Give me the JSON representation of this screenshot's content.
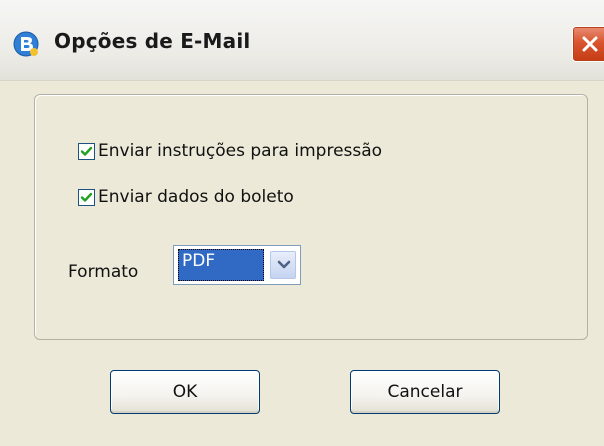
{
  "window": {
    "title": "Opções de E-Mail",
    "app_icon": "b-logo-icon",
    "close_icon": "close-icon"
  },
  "options": {
    "send_instructions": {
      "label": "Enviar instruções para impressão",
      "checked": true
    },
    "send_data": {
      "label": "Enviar dados do boleto",
      "checked": true
    }
  },
  "format": {
    "label": "Formato",
    "selected": "PDF"
  },
  "buttons": {
    "ok": "OK",
    "cancel": "Cancelar"
  },
  "colors": {
    "close_button": "#d9552f",
    "selection": "#316ac5",
    "check_mark": "#21a121"
  }
}
